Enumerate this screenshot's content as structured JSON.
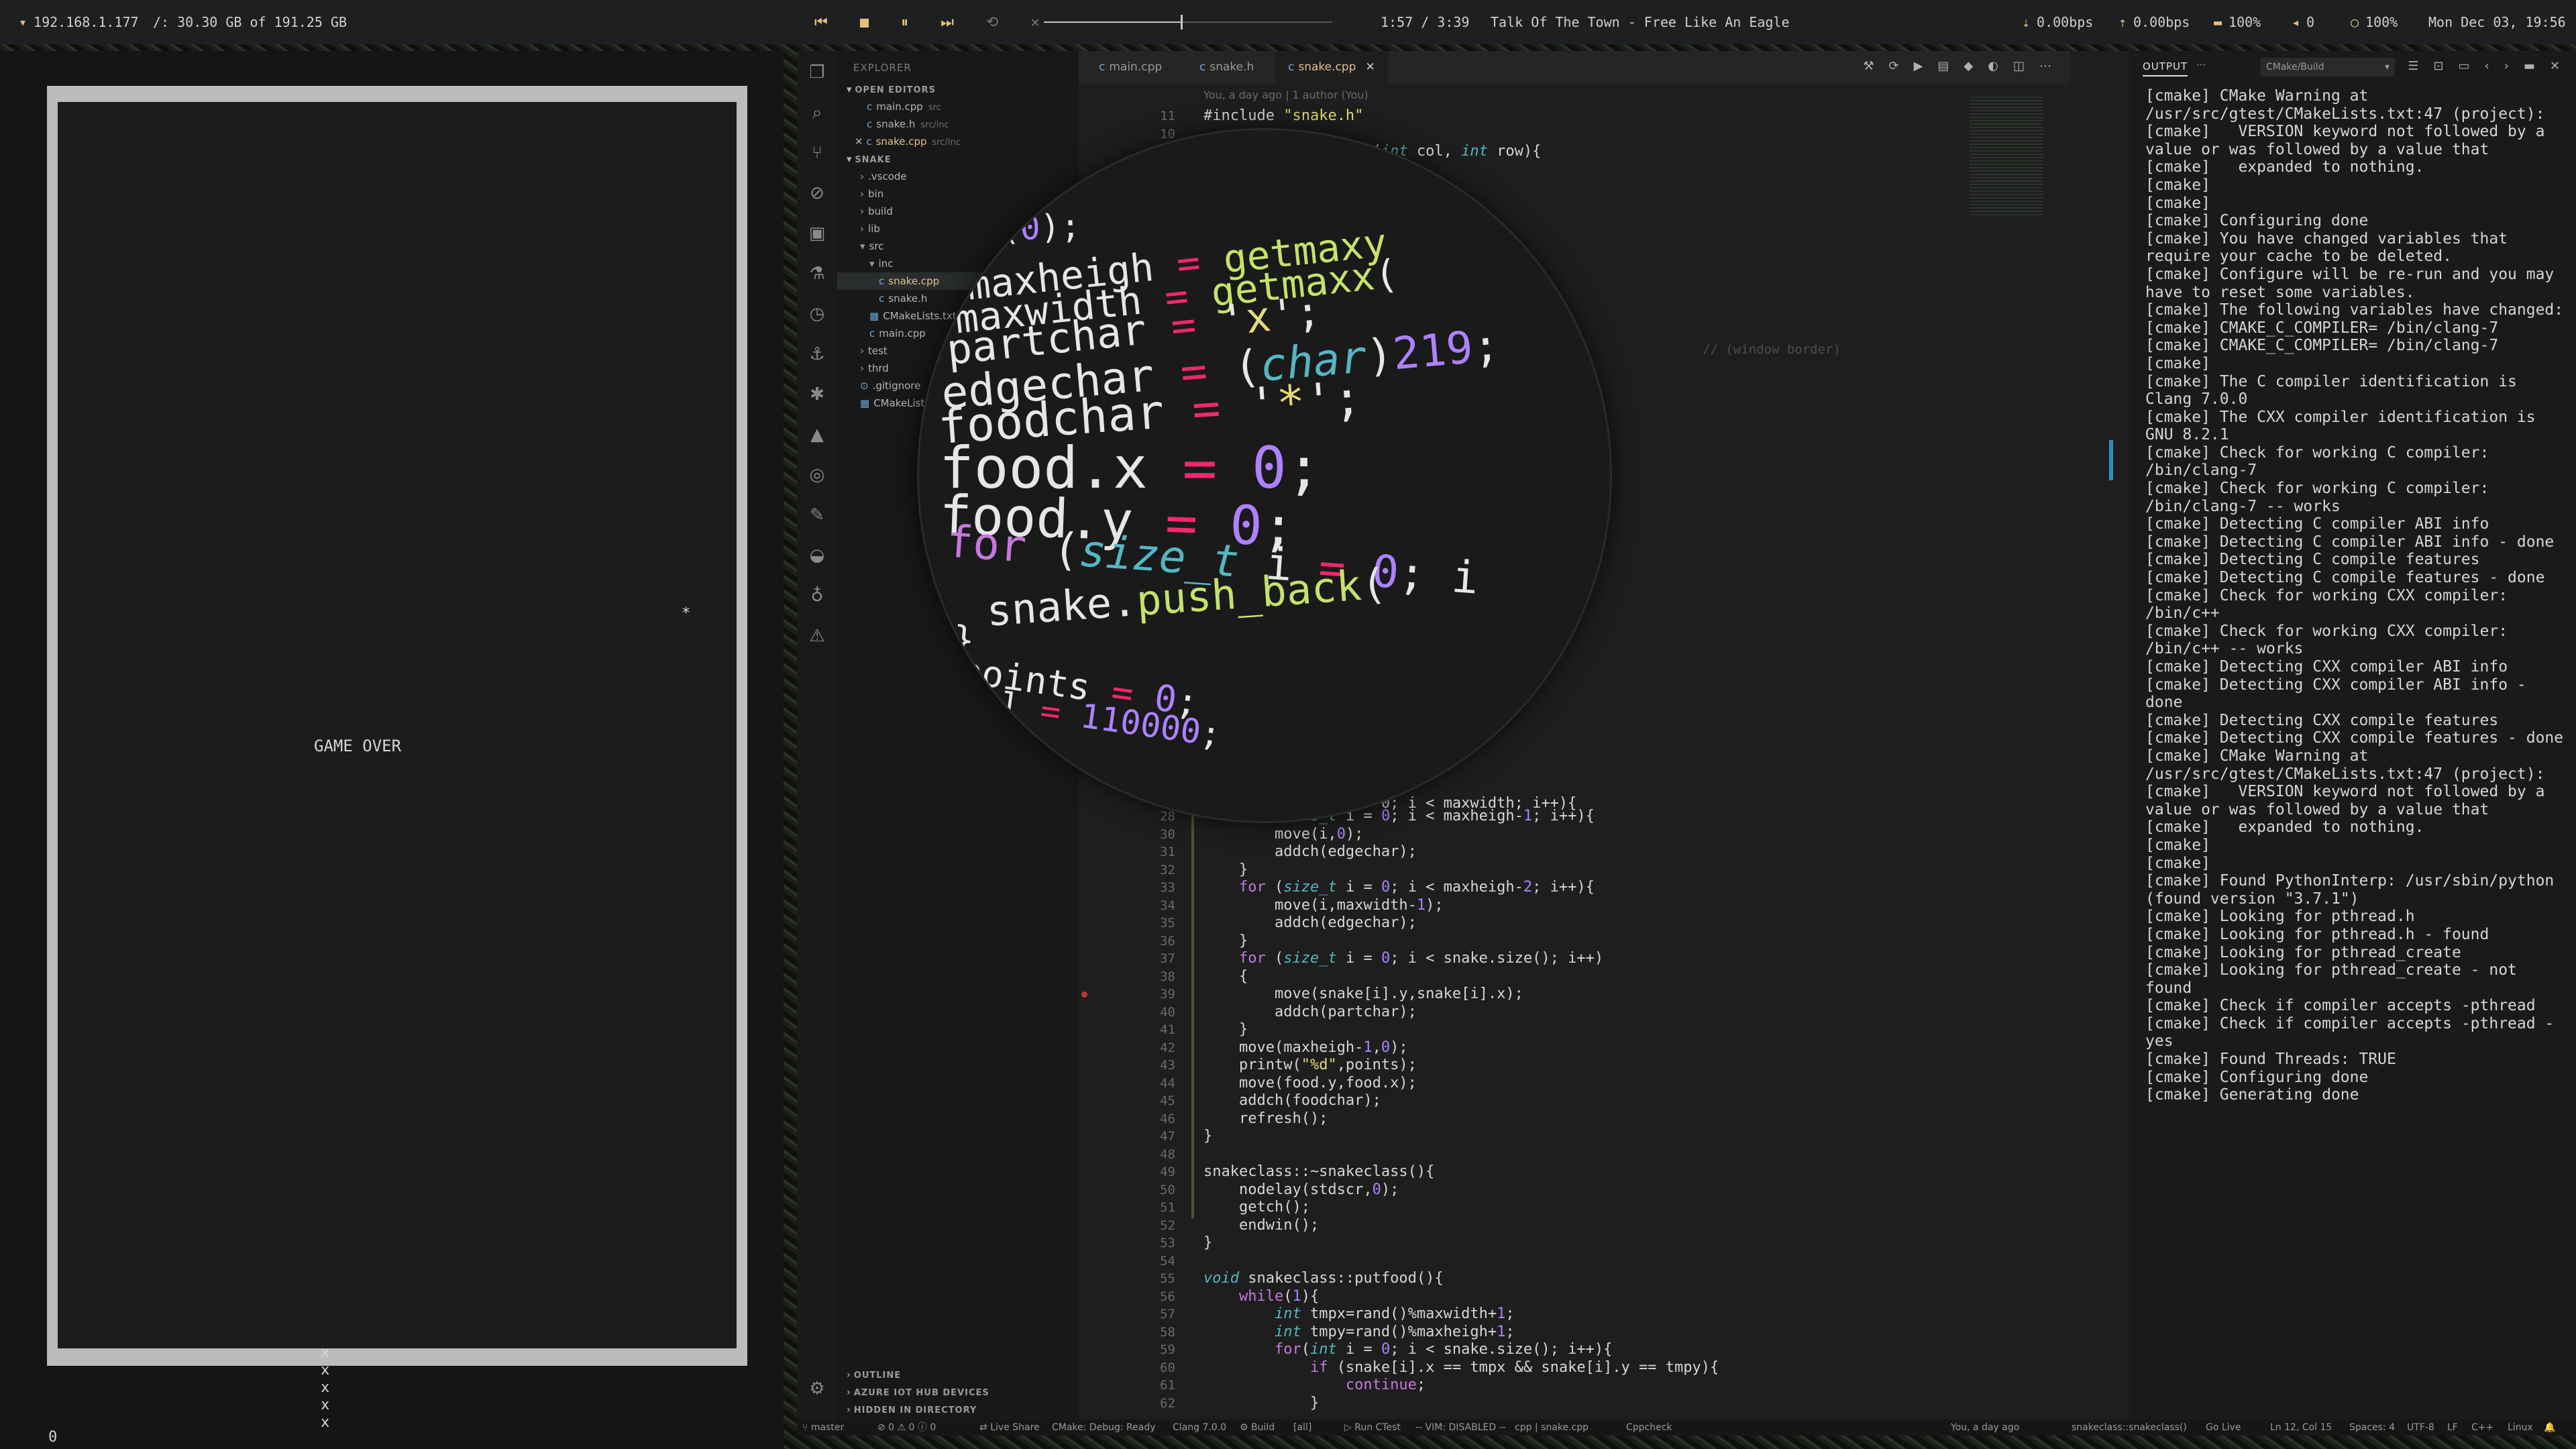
{
  "topbar": {
    "ip": "192.168.1.177",
    "disk": "/: 30.30 GB of 191.25 GB",
    "media": {
      "prev": "⏮",
      "stop": "■",
      "pause": "⏸",
      "next": "⏭",
      "repeat": "⟲",
      "shuffle": "✕"
    },
    "progress_fraction": 0.475,
    "time": "1:57 / 3:39",
    "track_title": "Talk Of The Town - Free Like An Eagle",
    "net_down": "0.00bps",
    "net_up": "0.00bps",
    "battery": "100%",
    "volume": "0",
    "brightness": "100%",
    "datetime": "Mon Dec 03, 19:56"
  },
  "game": {
    "message": "GAME OVER",
    "food": "*",
    "snake": [
      "x",
      "x",
      "x",
      "x",
      "x"
    ],
    "points": "0"
  },
  "sidebar": {
    "title": "EXPLORER",
    "open_editors_label": "OPEN EDITORS",
    "open_editors": [
      {
        "name": "main.cpp",
        "path": "src"
      },
      {
        "name": "snake.h",
        "path": "src/inc"
      },
      {
        "name": "snake.cpp",
        "path": "src/inc"
      }
    ],
    "project_label": "SNAKE",
    "tree": [
      {
        "name": ".vscode",
        "depth": 1
      },
      {
        "name": "bin",
        "depth": 1
      },
      {
        "name": "build",
        "depth": 1
      },
      {
        "name": "lib",
        "depth": 1
      },
      {
        "name": "src",
        "depth": 1
      },
      {
        "name": "inc",
        "depth": 2
      },
      {
        "name": "snake.cpp",
        "depth": 3
      },
      {
        "name": "snake.h",
        "depth": 3
      },
      {
        "name": "CMakeLists.txt",
        "depth": 2
      },
      {
        "name": "main.cpp",
        "depth": 2
      },
      {
        "name": "test",
        "depth": 1
      },
      {
        "name": "thrd",
        "depth": 1
      },
      {
        "name": ".gitignore",
        "depth": 1
      },
      {
        "name": "CMakeLists.txt",
        "depth": 1
      }
    ],
    "outline_label": "OUTLINE",
    "azure_label": "AZURE IOT HUB DEVICES",
    "hidden_label": "HIDDEN IN DIRECTORY"
  },
  "tabs": [
    {
      "label": "main.cpp"
    },
    {
      "label": "snake.h"
    },
    {
      "label": "snake.cpp",
      "active": true
    }
  ],
  "editor": {
    "blame": "You, a day ago | 1 author (You)",
    "code_top": [
      {
        "n": "11",
        "t": "#include \"snake.h\""
      },
      {
        "n": "10",
        "t": ""
      },
      {
        "n": "9",
        "t": "snakeclass::putpart(int col, int row){"
      }
    ],
    "code_bottom": [
      {
        "n": "28",
        "t": "    for (size_t i = 0; i < maxheigh-1; i++){"
      },
      {
        "n": "30",
        "t": "        move(i,0);"
      },
      {
        "n": "31",
        "t": "        addch(edgechar);"
      },
      {
        "n": "32",
        "t": "    }"
      },
      {
        "n": "33",
        "t": "    for (size_t i = 0; i < maxheigh-2; i++){"
      },
      {
        "n": "34",
        "t": "        move(i,maxwidth-1);"
      },
      {
        "n": "35",
        "t": "        addch(edgechar);"
      },
      {
        "n": "36",
        "t": "    }"
      },
      {
        "n": "37",
        "t": "    for (size_t i = 0; i < snake.size(); i++)"
      },
      {
        "n": "38",
        "t": "    {"
      },
      {
        "n": "39",
        "t": "        move(snake[i].y,snake[i].x);"
      },
      {
        "n": "40",
        "t": "        addch(partchar);"
      },
      {
        "n": "41",
        "t": "    }"
      },
      {
        "n": "42",
        "t": "    move(maxheigh-1,0);"
      },
      {
        "n": "43",
        "t": "    printw(\"%d\",points);"
      },
      {
        "n": "44",
        "t": "    move(food.y,food.x);"
      },
      {
        "n": "45",
        "t": "    addch(foodchar);"
      },
      {
        "n": "46",
        "t": "    refresh();"
      },
      {
        "n": "47",
        "t": "}"
      },
      {
        "n": "48",
        "t": ""
      },
      {
        "n": "49",
        "t": "snakeclass::~snakeclass(){"
      },
      {
        "n": "50",
        "t": "    nodelay(stdscr,0);"
      },
      {
        "n": "51",
        "t": "    getch();"
      },
      {
        "n": "52",
        "t": "    endwin();"
      },
      {
        "n": "53",
        "t": "}"
      },
      {
        "n": "54",
        "t": ""
      },
      {
        "n": "55",
        "t": "void snakeclass::putfood(){"
      },
      {
        "n": "56",
        "t": "    while(1){"
      },
      {
        "n": "57",
        "t": "        int tmpx=rand()%maxwidth+1;"
      },
      {
        "n": "58",
        "t": "        int tmpy=rand()%maxheigh+1;"
      },
      {
        "n": "59",
        "t": "        for(int i = 0; i < snake.size(); i++){"
      },
      {
        "n": "60",
        "t": "            if (snake[i].x == tmpx && snake[i].y == tmpy){"
      },
      {
        "n": "61",
        "t": "                continue;"
      },
      {
        "n": "62",
        "t": "            }"
      }
    ],
    "side_hint": "// (window border)",
    "partial_line": "    for (size_t i = 0; i < maxwidth; i++){",
    "lens": [
      "_set(0);",
      "maxheigh  =  getmaxy",
      "maxwidth  =  getmaxx(",
      "partchar  =  'x';",
      "edgechar  =  (char)219;",
      "foodchar  =  '*';",
      "food.x  =  0;",
      "food.y  =  0;",
      "for (size_t i = 0; i",
      "    snake.push_back(",
      "}",
      "points  =  0;",
      "l  =  110000;"
    ]
  },
  "panel": {
    "tab": "OUTPUT",
    "more": "···",
    "selector": "CMake/Build",
    "lines": [
      "[cmake] CMake Warning at",
      "/usr/src/gtest/CMakeLists.txt:47 (project):",
      "[cmake]   VERSION keyword not followed by a",
      "value or was followed by a value that",
      "[cmake]   expanded to nothing.",
      "[cmake]",
      "[cmake]",
      "[cmake] Configuring done",
      "[cmake] You have changed variables that",
      "require your cache to be deleted.",
      "[cmake] Configure will be re-run and you may",
      "have to reset some variables.",
      "[cmake] The following variables have changed:",
      "[cmake] CMAKE_C_COMPILER= /bin/clang-7",
      "[cmake] CMAKE_C_COMPILER= /bin/clang-7",
      "[cmake]",
      "[cmake] The C compiler identification is",
      "Clang 7.0.0",
      "[cmake] The CXX compiler identification is",
      "GNU 8.2.1",
      "[cmake] Check for working C compiler:",
      "/bin/clang-7",
      "[cmake] Check for working C compiler:",
      "/bin/clang-7 -- works",
      "[cmake] Detecting C compiler ABI info",
      "[cmake] Detecting C compiler ABI info - done",
      "[cmake] Detecting C compile features",
      "[cmake] Detecting C compile features - done",
      "[cmake] Check for working CXX compiler:",
      "/bin/c++",
      "[cmake] Check for working CXX compiler:",
      "/bin/c++ -- works",
      "[cmake] Detecting CXX compiler ABI info",
      "[cmake] Detecting CXX compiler ABI info -",
      "done",
      "[cmake] Detecting CXX compile features",
      "[cmake] Detecting CXX compile features - done",
      "[cmake] CMake Warning at",
      "/usr/src/gtest/CMakeLists.txt:47 (project):",
      "[cmake]   VERSION keyword not followed by a",
      "value or was followed by a value that",
      "[cmake]   expanded to nothing.",
      "[cmake]",
      "[cmake]",
      "[cmake] Found PythonInterp: /usr/sbin/python",
      "(found version \"3.7.1\")",
      "[cmake] Looking for pthread.h",
      "[cmake] Looking for pthread.h - found",
      "[cmake] Looking for pthread_create",
      "[cmake] Looking for pthread_create - not",
      "found",
      "[cmake] Check if compiler accepts -pthread",
      "[cmake] Check if compiler accepts -pthread -",
      "yes",
      "[cmake] Found Threads: TRUE",
      "[cmake] Configuring done",
      "[cmake] Generating done"
    ]
  },
  "statusbar": {
    "branch": "master",
    "problems": "⊘ 0 ⚠ 0 ⓘ 0",
    "live_share": "Live Share",
    "cmake_status": "CMake: Debug: Ready",
    "kit": "Clang 7.0.0",
    "build": "Build",
    "target": "[all]",
    "run": "Run CTest",
    "vim": "-- VIM: DISABLED --",
    "lang_file": "cpp | snake.cpp",
    "cppcheck": "Cppcheck",
    "blame": "You, a day ago",
    "scope": "snakeclass::snakeclass()",
    "golive": "Go Live",
    "position": "Ln 12, Col 15",
    "spaces": "Spaces: 4",
    "encoding": "UTF-8",
    "eol": "LF",
    "language": "C++",
    "os": "Linux"
  }
}
